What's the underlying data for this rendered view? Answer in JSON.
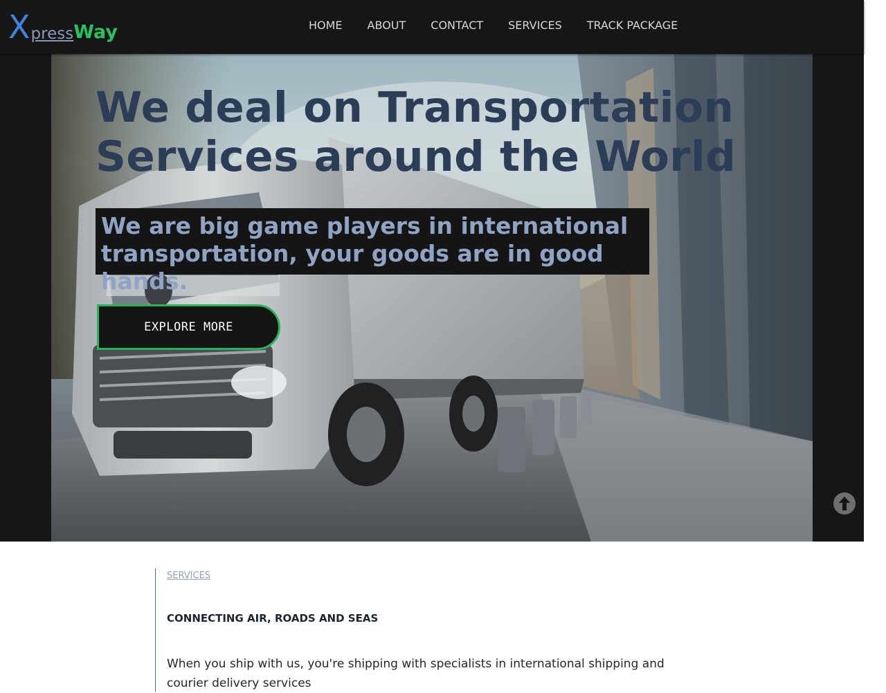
{
  "header": {
    "logo": {
      "x": "X",
      "press": "press",
      "way": "Way"
    },
    "nav": [
      {
        "label": "HOME"
      },
      {
        "label": "ABOUT"
      },
      {
        "label": "CONTACT"
      },
      {
        "label": "SERVICES"
      },
      {
        "label": "TRACK PACKAGE"
      }
    ]
  },
  "hero": {
    "title": "We deal on Transportation Services around the World",
    "subtitle": "We are big game players in international transportation, your goods are in good hands.",
    "cta_label": "EXPLORE MORE"
  },
  "services": {
    "link_label": "SERVICES",
    "heading": "CONNECTING AIR, ROADS AND SEAS",
    "description": "When you ship with us, you're shipping with specialists in international shipping and courier delivery services"
  },
  "colors": {
    "header_bg": "#161616",
    "logo_x": "#3f84df",
    "logo_press": "#8798b6",
    "logo_way": "#27c25f",
    "hero_title": "#2c3e57",
    "hero_subtitle": "#8fa3c4",
    "cta_border": "#26b45a",
    "services_link": "#8ea3c3"
  },
  "icons": {
    "scroll_top": "arrow-up-circle-icon"
  }
}
